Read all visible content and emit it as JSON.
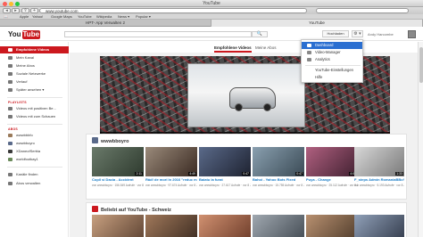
{
  "window": {
    "title": "YouTube"
  },
  "browser": {
    "url": "www.youtube.com",
    "bookmarks": [
      "Apple",
      "Yahoo!",
      "Google Maps",
      "YouTube",
      "Wikipedia",
      "News ▾",
      "Popular ▾"
    ],
    "tabs": [
      {
        "label": "HPT- App Verwalten 2",
        "active": false
      },
      {
        "label": "YouTube",
        "active": true
      }
    ]
  },
  "youtube": {
    "logo": {
      "you": "You",
      "tube": "Tube",
      "region": "DE"
    },
    "search_button": "🔍",
    "upload_label": "Hochladen",
    "gear_label": "⚙ ▾",
    "username": "Andy Harcombe"
  },
  "sidebar": {
    "items": [
      {
        "label": "Empfohlene Videos",
        "active": true
      },
      {
        "label": "Mein Kanal",
        "active": false
      },
      {
        "label": "Meine Abos",
        "active": false
      },
      {
        "label": "Soziale Netzwerke",
        "active": false
      },
      {
        "label": "Verlauf",
        "active": false
      },
      {
        "label": "Später ansehen ▾",
        "active": false
      }
    ],
    "playlists_heading": "PLAYLISTS",
    "playlists": [
      {
        "label": "Videos mit positiven Be..."
      },
      {
        "label": "Videos mit zum Schauen"
      }
    ],
    "subs_heading": "ABOS",
    "subs": [
      {
        "label": "wwwbbbfo"
      },
      {
        "label": "wwwbboyro"
      },
      {
        "label": "XDaneofSerbia"
      },
      {
        "label": "worldfootkay1"
      }
    ],
    "bottom": [
      {
        "label": "Kanäle finden"
      },
      {
        "label": "Abos verwalten"
      }
    ]
  },
  "main": {
    "subtabs": [
      {
        "label": "Empfohlene Videos",
        "active": true
      },
      {
        "label": "Meine Abos",
        "active": false
      }
    ],
    "section1": {
      "title": "wwwbboyro",
      "videos": [
        {
          "title": "Copil si Dacia - Accident",
          "meta": "von wwwbboyro · 156.549 Aufrufe · vor 8 Jahren",
          "duration": "2:11"
        },
        {
          "title": "Râd! de mori în 2016 \"reduc minsk\"",
          "meta": "von wwwbboyro · 97.674 Aufrufe · vor 8 Jahren",
          "duration": "4:49"
        },
        {
          "title": "Baiatu la furat",
          "meta": "von wwwbboyro · 27.617 Aufrufe · vor 8 Jahren",
          "duration": "0:47"
        },
        {
          "title": "Bahoi - Yahoo Bots Fixed",
          "meta": "von wwwbboyro · 15.755 Aufrufe · vor 8 Jahren",
          "duration": "0:47"
        },
        {
          "title": "Puya - Change",
          "meta": "von wwwbboyro · 25.112 Aufrufe · vor 8 Jahren",
          "duration": "4:09"
        },
        {
          "title": "F_steps Admin RomaniaBBoY",
          "meta": "von wwwbboyro · 5.193 Aufrufe · vor 8 Jahren",
          "duration": "1:33"
        }
      ]
    },
    "section2": {
      "title": "Beliebt auf YouTube - Schweiz"
    }
  },
  "dropdown": {
    "items": [
      {
        "label": "Dashboard",
        "highlighted": true
      },
      {
        "label": "Video-Manager",
        "highlighted": false
      },
      {
        "label": "Analytics",
        "highlighted": false
      },
      {
        "label": "YouTube-Einstellungen",
        "highlighted": false
      },
      {
        "label": "Hilfe",
        "highlighted": false
      }
    ]
  },
  "colors": {
    "brand_red": "#cc181e",
    "link_blue": "#167ac6",
    "highlight": "#2a6fd1"
  }
}
